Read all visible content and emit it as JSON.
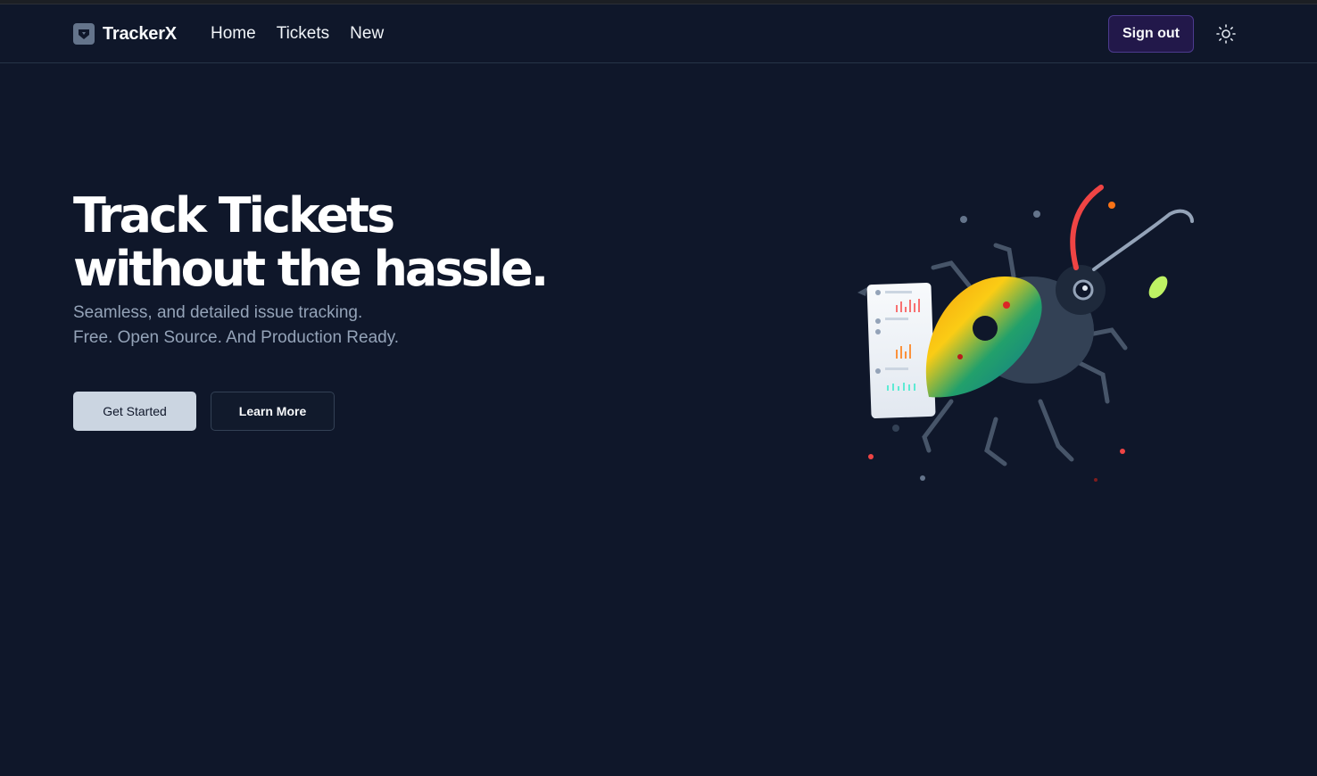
{
  "app": {
    "brand_name": "TrackerX",
    "nav": [
      {
        "label": "Home"
      },
      {
        "label": "Tickets"
      },
      {
        "label": "New"
      }
    ],
    "sign_out_label": "Sign out",
    "theme_toggle_icon": "sun-icon"
  },
  "hero": {
    "title_line1": "Track Tickets",
    "title_line2": "without the hassle.",
    "subtitle_line1": "Seamless, and detailed issue tracking.",
    "subtitle_line2": "Free. Open Source. And Production Ready.",
    "primary_button": "Get Started",
    "secondary_button": "Learn More",
    "illustration_icon": "beetle-illustration"
  },
  "colors": {
    "background": "#0f172a",
    "primary_button_bg": "#cbd5e1",
    "sign_out_bg": "#22184a"
  }
}
